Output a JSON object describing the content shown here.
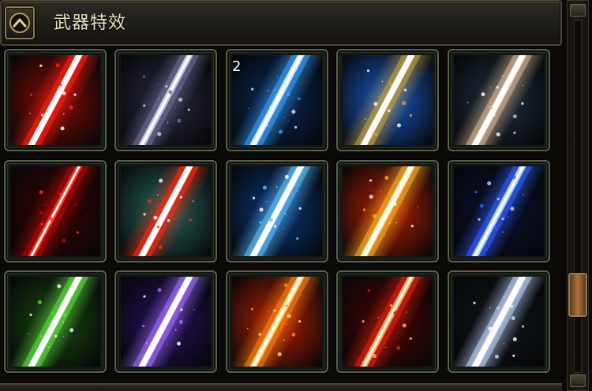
{
  "header": {
    "title": "武器特效",
    "collapse_icon": "chevron-up-icon"
  },
  "grid": {
    "tiles": [
      {
        "name": "red-fire-blade",
        "colors": [
          "#ff2010",
          "#8a0a05",
          "#ffffff"
        ],
        "count": ""
      },
      {
        "name": "dark-shadow-blade",
        "colors": [
          "#6e6f98",
          "#2a2a40",
          "#d0d0e0"
        ],
        "count": ""
      },
      {
        "name": "blue-rune-blade",
        "colors": [
          "#3aa0ff",
          "#0a2a5a",
          "#e0f0ff"
        ],
        "count": "2"
      },
      {
        "name": "golden-crystal-blade",
        "colors": [
          "#c8a040",
          "#1a60d0",
          "#ffffff"
        ],
        "count": ""
      },
      {
        "name": "white-light-blade",
        "colors": [
          "#d8b890",
          "#203040",
          "#ffffff"
        ],
        "count": ""
      },
      {
        "name": "crimson-mist",
        "colors": [
          "#b00808",
          "#3a0202",
          "#ff3020"
        ],
        "count": ""
      },
      {
        "name": "jade-blood-blade",
        "colors": [
          "#ff2810",
          "#2a6a60",
          "#ffffff"
        ],
        "count": ""
      },
      {
        "name": "ice-blue-blade",
        "colors": [
          "#60c0ff",
          "#0a3a80",
          "#ffffff"
        ],
        "count": ""
      },
      {
        "name": "flame-lightning-blade",
        "colors": [
          "#ffb020",
          "#c02000",
          "#fff8d0"
        ],
        "count": ""
      },
      {
        "name": "blue-twin-blade",
        "colors": [
          "#3060ff",
          "#0a1030",
          "#c0d8ff"
        ],
        "count": ""
      },
      {
        "name": "green-lightning-blade",
        "colors": [
          "#60e040",
          "#1a4a10",
          "#ffffff"
        ],
        "count": ""
      },
      {
        "name": "violet-arcane-blade",
        "colors": [
          "#a070ff",
          "#2a1060",
          "#ffffff"
        ],
        "count": ""
      },
      {
        "name": "inferno-blade",
        "colors": [
          "#ff8010",
          "#c02000",
          "#ffe080"
        ],
        "count": ""
      },
      {
        "name": "scarlet-ember-blade",
        "colors": [
          "#e02010",
          "#500500",
          "#ffb060"
        ],
        "count": ""
      },
      {
        "name": "storm-lightning-blade",
        "colors": [
          "#c0d8ff",
          "#101418",
          "#ffffff"
        ],
        "count": ""
      }
    ]
  },
  "scrollbar": {
    "position": 0.82
  }
}
